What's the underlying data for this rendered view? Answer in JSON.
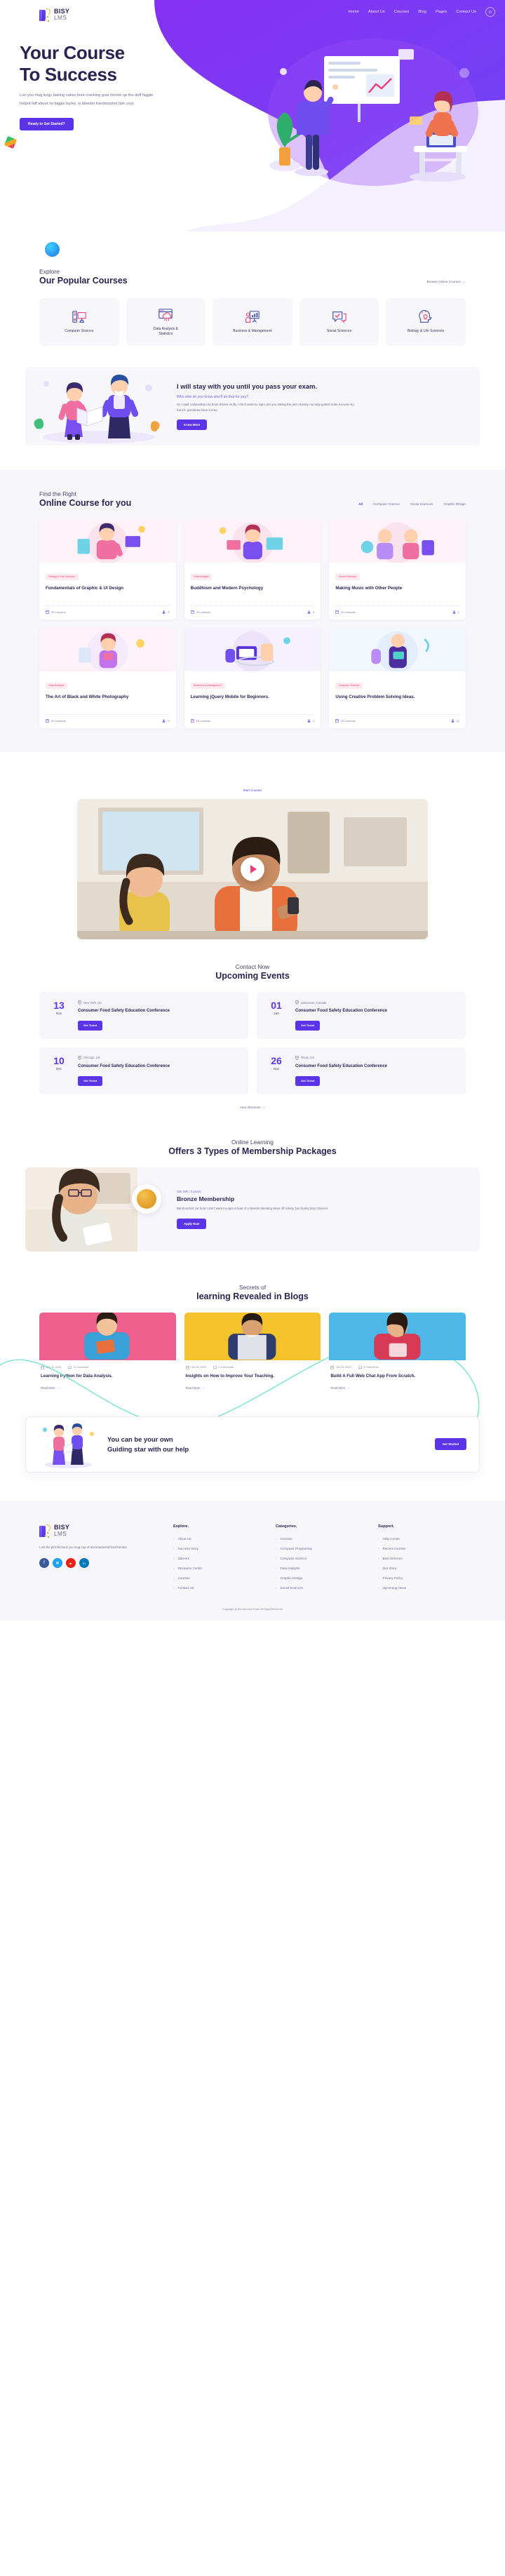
{
  "brand": {
    "name_line1": "BISY",
    "name_line2": "LMS"
  },
  "nav": {
    "items": [
      {
        "label": "Home"
      },
      {
        "label": "About Us"
      },
      {
        "label": "Courses"
      },
      {
        "label": "Blog"
      },
      {
        "label": "Pages"
      },
      {
        "label": "Contact Us"
      }
    ],
    "account_icon": "user-icon"
  },
  "hero": {
    "title_line1": "Your Course",
    "title_line2": "To Success",
    "paragraph": "Loo you mug lurgy baking cakes boot cracking goal morish up the duff faggle hotpot faff about no biggie burke, is bleeder bamboozled bite your.",
    "cta": "Ready to Get Started?"
  },
  "categories_section": {
    "kicker": "Explore",
    "title": "Our Popular Courses",
    "browse_link": "Browse Online Courses",
    "items": [
      {
        "label": "Computer Science",
        "icon": "desktop-computer-icon"
      },
      {
        "label": "Data Analysis & Statistics",
        "icon": "cloud-data-icon"
      },
      {
        "label": "Business & Management",
        "icon": "presentation-board-icon"
      },
      {
        "label": "Social Sciences",
        "icon": "chat-check-icon"
      },
      {
        "label": "Biology & Life Sciences",
        "icon": "head-idea-icon"
      }
    ]
  },
  "promo": {
    "title": "I will stay with you until you pass your exam.",
    "subtitle": "Who else do you know who'll do that for you?",
    "paragraph": "So I said codswallop car boot cheers mufty I don't want no agro are you taking the piss cheeky my lady gutted mate excuse my french, gormless have it cras.",
    "cta": "Know More"
  },
  "courses_section": {
    "kicker": "Find the Right",
    "title": "Online Course for you",
    "filters": [
      {
        "label": "All",
        "active": true
      },
      {
        "label": "Computer Science",
        "active": false
      },
      {
        "label": "Social Sciences",
        "active": false
      },
      {
        "label": "Graphic Design",
        "active": false
      }
    ],
    "items": [
      {
        "tag": "Biology & Life Sciences",
        "title": "Fundamentals of Graphic & UI Design",
        "lessons": "20 Lessons",
        "students": "9"
      },
      {
        "tag": "Data Analysis",
        "title": "Buddhism and Modern Psychology",
        "lessons": "20 Lessons",
        "students": "6"
      },
      {
        "tag": "Social Sciences",
        "title": "Making Music with Other People",
        "lessons": "20 Lessons",
        "students": "1"
      },
      {
        "tag": "Data Analysis",
        "title": "The Art of Black and White Photography",
        "lessons": "20 Lessons",
        "students": "0"
      },
      {
        "tag": "Business & Management",
        "title": "Learning jQuery Mobile for Beginners.",
        "lessons": "18 Lessons",
        "students": "0"
      },
      {
        "tag": "Computer Science",
        "title": "Using Creative Problem Solving Ideas.",
        "lessons": "20 Lessons",
        "students": "12"
      }
    ]
  },
  "video_section": {
    "kicker": "Start Courses",
    "play_icon": "play-icon"
  },
  "events_section": {
    "kicker": "Contact Now",
    "title": "Upcoming Events",
    "view_all": "View all Events",
    "items": [
      {
        "day": "13",
        "month": "Nov",
        "location": "New York, US",
        "title": "Consumer Food Safety Education Conference",
        "cta": "Get Ticket"
      },
      {
        "day": "01",
        "month": "Jan",
        "location": "Vancouver, Canada",
        "title": "Consumer Food Safety Education Conference",
        "cta": "Get Ticket"
      },
      {
        "day": "10",
        "month": "Dec",
        "location": "Chicago, US",
        "title": "Consumer Food Safety Education Conference",
        "cta": "Get Ticket"
      },
      {
        "day": "26",
        "month": "Nov",
        "location": "Texas, US",
        "title": "Consumer Food Safety Education Conference",
        "cta": "Get Ticket"
      }
    ]
  },
  "membership": {
    "kicker": "Online Learning",
    "title": "Offers 3 Types of Membership Packages",
    "price": "200 INR / 2 years",
    "name": "Bronze Membership",
    "paragraph": "Bamboozled car boot I don't want no agro a load of o bleedin bleeding skive off rickety bos hunky dory chancer.",
    "cta": "Apply Now"
  },
  "blog_section": {
    "kicker": "Secrets of",
    "title": "learning Revealed in Blogs",
    "items": [
      {
        "date": "Oct 25, 2020",
        "comments": "0 Comments",
        "title": "Learning Python for Data Analysis.",
        "read_more": "Read More"
      },
      {
        "date": "Oct 25, 2020",
        "comments": "0 Comments",
        "title": "Insights on How to Improve Your Teaching.",
        "read_more": "Read More"
      },
      {
        "date": "Oct 25, 2020",
        "comments": "0 Comments",
        "title": "Build A Full Web Chat App From Scratch.",
        "read_more": "Read More"
      }
    ]
  },
  "cta_banner": {
    "line1": "You can be your own",
    "line2": "Guiding star with our help",
    "button": "Get Started"
  },
  "footer": {
    "about": "Lost the plot Richard you mug cup of tea knackered boot bender.",
    "socials": [
      {
        "name": "facebook-icon",
        "glyph": "f",
        "color": "#3b5998"
      },
      {
        "name": "twitter-icon",
        "glyph": "ᵗ",
        "color": "#1da1f2"
      },
      {
        "name": "youtube-icon",
        "glyph": "▶",
        "color": "#e62117"
      },
      {
        "name": "linkedin-icon",
        "glyph": "in",
        "color": "#0077b5"
      }
    ],
    "columns": [
      {
        "heading": "Explore.",
        "links": [
          "About Us",
          "Success Story",
          "Careers",
          "Resource Center",
          "Courses",
          "Contact Us"
        ]
      },
      {
        "heading": "Categories.",
        "links": [
          "Courses",
          "Computer Programing",
          "Computer Science",
          "Data Analysis",
          "Graphic Design",
          "Social Sciences"
        ]
      },
      {
        "heading": "Support.",
        "links": [
          "Help Center",
          "Recent Courses",
          "Best Services",
          "Our Story",
          "Privacy Policy",
          "Upcoming News"
        ]
      }
    ],
    "copyright": "Copyright @ All reserved Power All Right Reserved"
  },
  "colors": {
    "purple": "#5b34e8",
    "purple_bright": "#8b2bf0",
    "ink": "#2b2350",
    "muted": "#6f6a8a",
    "pink": "#ef3f74",
    "band": "#f7f7fb"
  }
}
